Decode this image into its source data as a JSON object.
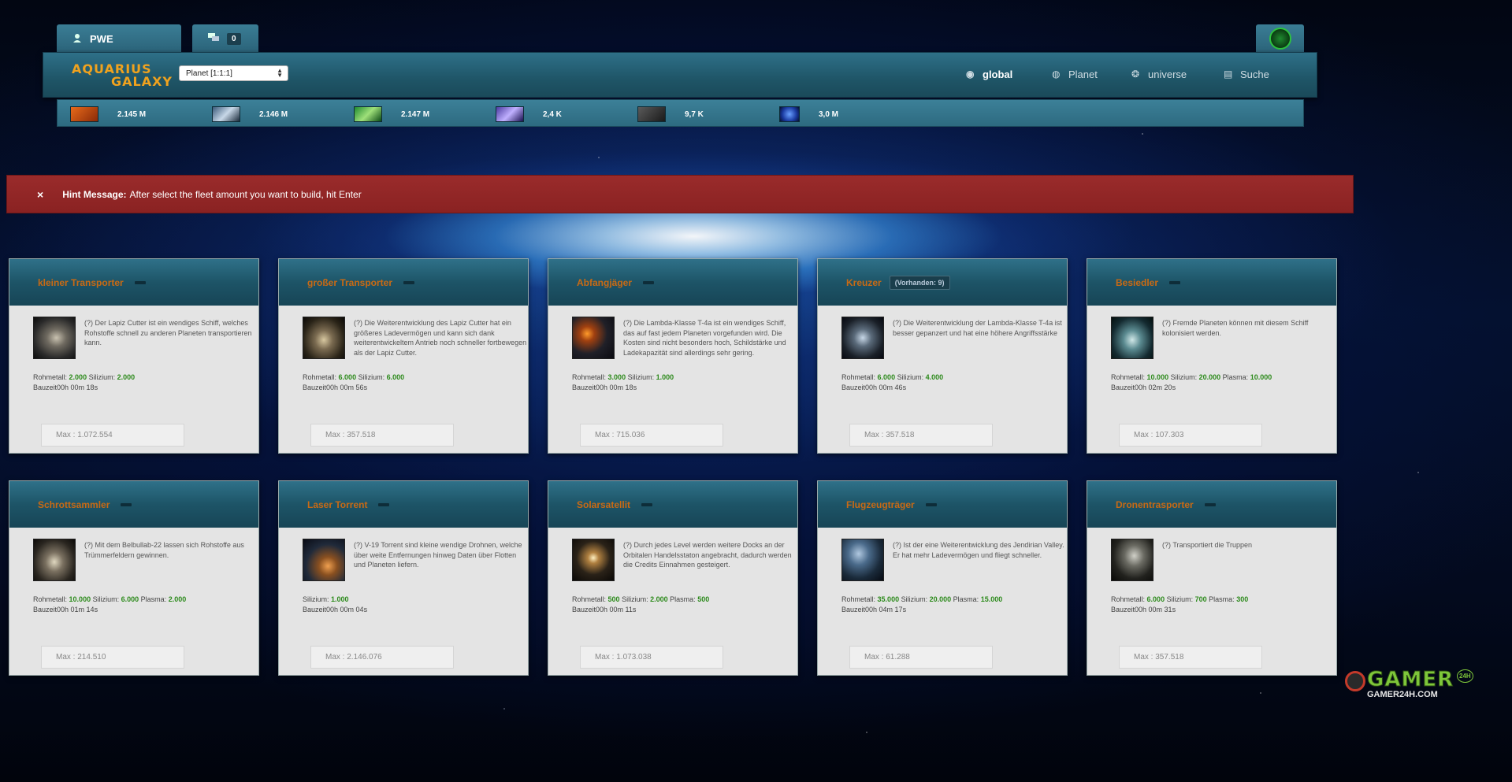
{
  "user": {
    "name": "PWE"
  },
  "messages": {
    "count": "0"
  },
  "brand": {
    "line1": "AQUARIUS",
    "line2": "GALAXY"
  },
  "planet_select": {
    "value": "Planet [1:1:1]"
  },
  "nav": [
    {
      "label": "global",
      "icon": "eye-icon"
    },
    {
      "label": "Planet",
      "icon": "planet-icon"
    },
    {
      "label": "universe",
      "icon": "universe-icon"
    },
    {
      "label": "Suche",
      "icon": "search-icon"
    }
  ],
  "resources": [
    {
      "value": "2.145 M",
      "icon": "rohmetall-icon",
      "color": "#c64a12"
    },
    {
      "value": "2.146 M",
      "icon": "silizium-icon",
      "color": "#2a4a6a"
    },
    {
      "value": "2.147 M",
      "icon": "plasma-icon",
      "color": "#1f8a2f"
    },
    {
      "value": "2,4 K",
      "icon": "energy-icon",
      "color": "#3a2a8a"
    },
    {
      "value": "9,7 K",
      "icon": "ore-icon",
      "color": "#3a3a3a"
    },
    {
      "value": "3,0 M",
      "icon": "credits-icon",
      "color": "#1a3aa0"
    }
  ],
  "hint": {
    "title": "Hint Message:",
    "text": "After select the fleet amount you want to build, hit Enter",
    "close": "×"
  },
  "ships": [
    {
      "name": "kleiner Transporter",
      "badge": "",
      "desc": "(?) Der Lapiz Cutter ist ein wendiges Schiff, welches Rohstoffe schnell zu anderen Planeten transportieren kann.",
      "cost": [
        [
          "Rohmetall:",
          "2.000"
        ],
        [
          "Silizium:",
          "2.000"
        ]
      ],
      "time_label": "Bauzeit",
      "time": "00h 00m 18s",
      "max": "Max : 1.072.554"
    },
    {
      "name": "großer Transporter",
      "badge": "",
      "desc": "(?) Die Weiterentwicklung des Lapiz Cutter hat ein größeres Ladevermögen und kann sich dank weiterentwickeltem Antrieb noch schneller fortbewegen als der Lapiz Cutter.",
      "cost": [
        [
          "Rohmetall:",
          "6.000"
        ],
        [
          "Silizium:",
          "6.000"
        ]
      ],
      "time_label": "Bauzeit",
      "time": "00h 00m 56s",
      "max": "Max : 357.518"
    },
    {
      "name": "Abfangjäger",
      "badge": "",
      "desc": "(?) Die Lambda-Klasse T-4a ist ein wendiges Schiff, das auf fast jedem Planeten vorgefunden wird. Die Kosten sind nicht besonders hoch, Schildstärke und Ladekapazität sind allerdings sehr gering.",
      "cost": [
        [
          "Rohmetall:",
          "3.000"
        ],
        [
          "Silizium:",
          "1.000"
        ]
      ],
      "time_label": "Bauzeit",
      "time": "00h 00m 18s",
      "max": "Max : 715.036"
    },
    {
      "name": "Kreuzer",
      "badge": "(Vorhanden: 9)",
      "desc": "(?) Die Weiterentwicklung der Lambda-Klasse T-4a ist besser gepanzert und hat eine höhere Angriffsstärke",
      "cost": [
        [
          "Rohmetall:",
          "6.000"
        ],
        [
          "Silizium:",
          "4.000"
        ]
      ],
      "time_label": "Bauzeit",
      "time": "00h 00m 46s",
      "max": "Max : 357.518"
    },
    {
      "name": "Besiedler",
      "badge": "",
      "desc": "(?) Fremde Planeten können mit diesem Schiff kolonisiert werden.",
      "cost": [
        [
          "Rohmetall:",
          "10.000"
        ],
        [
          "Silizium:",
          "20.000"
        ],
        [
          "Plasma:",
          "10.000"
        ]
      ],
      "time_label": "Bauzeit",
      "time": "00h 02m 20s",
      "max": "Max : 107.303"
    },
    {
      "name": "Schrottsammler",
      "badge": "",
      "desc": "(?) Mit dem Belbullab-22 lassen sich Rohstoffe aus Trümmerfeldern gewinnen.",
      "cost": [
        [
          "Rohmetall:",
          "10.000"
        ],
        [
          "Silizium:",
          "6.000"
        ],
        [
          "Plasma:",
          "2.000"
        ]
      ],
      "time_label": "Bauzeit",
      "time": "00h 01m 14s",
      "max": "Max : 214.510"
    },
    {
      "name": "Laser Torrent",
      "badge": "",
      "desc": "(?) V-19 Torrent sind kleine wendige Drohnen, welche über weite Entfernungen hinweg Daten über Flotten und Planeten liefern.",
      "cost": [
        [
          "Silizium:",
          "1.000"
        ]
      ],
      "time_label": "Bauzeit",
      "time": "00h 00m 04s",
      "max": "Max : 2.146.076"
    },
    {
      "name": "Solarsatellit",
      "badge": "",
      "desc": "(?) Durch jedes Level werden weitere Docks an der Orbitalen Handelsstaton angebracht, dadurch werden die Credits Einnahmen gesteigert.",
      "cost": [
        [
          "Rohmetall:",
          "500"
        ],
        [
          "Silizium:",
          "2.000"
        ],
        [
          "Plasma:",
          "500"
        ]
      ],
      "time_label": "Bauzeit",
      "time": "00h 00m 11s",
      "max": "Max : 1.073.038"
    },
    {
      "name": "Flugzeugträger",
      "badge": "",
      "desc": "(?) Ist der eine Weiterentwicklung des Jendirian Valley. Er hat mehr Ladevermögen und fliegt schneller.",
      "cost": [
        [
          "Rohmetall:",
          "35.000"
        ],
        [
          "Silizium:",
          "20.000"
        ],
        [
          "Plasma:",
          "15.000"
        ]
      ],
      "time_label": "Bauzeit",
      "time": "00h 04m 17s",
      "max": "Max : 61.288"
    },
    {
      "name": "Dronentrasporter",
      "badge": "",
      "desc": "(?) Transportiert die Truppen",
      "cost": [
        [
          "Rohmetall:",
          "6.000"
        ],
        [
          "Silizium:",
          "700"
        ],
        [
          "Plasma:",
          "300"
        ]
      ],
      "time_label": "Bauzeit",
      "time": "00h 00m 31s",
      "max": "Max : 357.518"
    }
  ],
  "watermark": {
    "big": "GAMER",
    "small": "GAMER24H.COM",
    "tag": "24H"
  }
}
